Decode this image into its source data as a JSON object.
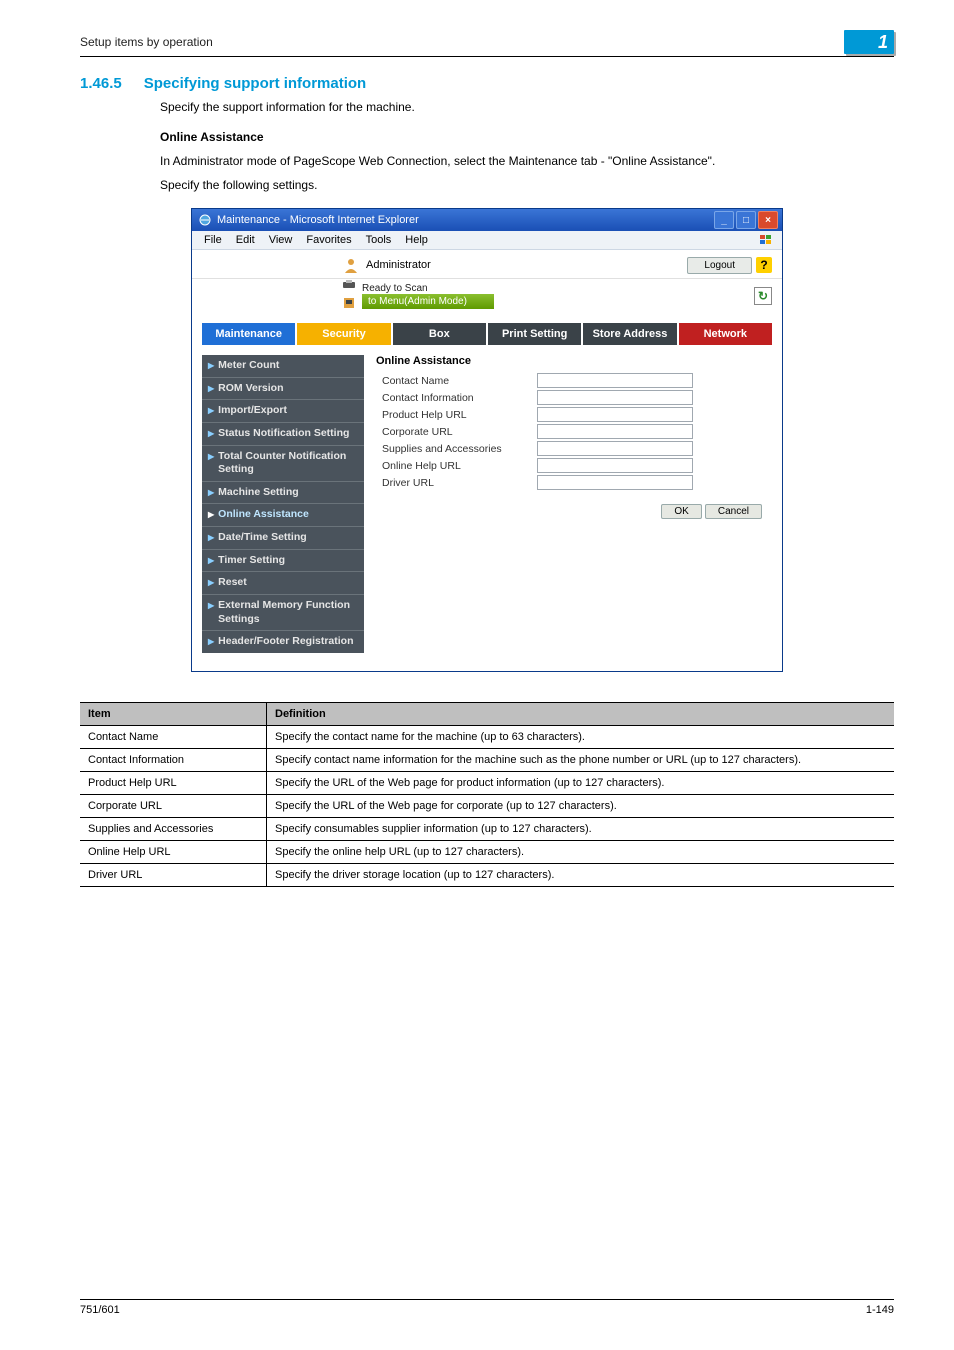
{
  "header": {
    "breadcrumb": "Setup items by operation",
    "chapter_number": "1"
  },
  "section": {
    "number": "1.46.5",
    "title": "Specifying support information",
    "intro": "Specify the support information for the machine.",
    "subheading": "Online Assistance",
    "para1": "In Administrator mode of PageScope Web Connection, select the Maintenance tab - \"Online Assistance\".",
    "para2": "Specify the following settings."
  },
  "chart_data": {
    "type": "table",
    "title": "Item / Definition",
    "columns": [
      "Item",
      "Definition"
    ],
    "rows": [
      [
        "Contact Name",
        "Specify the contact name for the machine (up to 63 characters)."
      ],
      [
        "Contact Information",
        "Specify contact name information for the machine such as the phone number or URL (up to 127 characters)."
      ],
      [
        "Product Help URL",
        "Specify the URL of the Web page for product information (up to 127 characters)."
      ],
      [
        "Corporate URL",
        "Specify the URL of the Web page for corporate (up to 127 characters)."
      ],
      [
        "Supplies and Accessories",
        "Specify consumables supplier information (up to 127 characters)."
      ],
      [
        "Online Help URL",
        "Specify the online help URL (up to 127 characters)."
      ],
      [
        "Driver URL",
        "Specify the driver storage location (up to 127 characters)."
      ]
    ]
  },
  "screenshot": {
    "window_title": "Maintenance - Microsoft Internet Explorer",
    "menus": [
      "File",
      "Edit",
      "View",
      "Favorites",
      "Tools",
      "Help"
    ],
    "admin_bar": {
      "role": "Administrator",
      "logout": "Logout",
      "help": "?"
    },
    "status": {
      "line1": "Ready to Scan",
      "line2": "to Menu(Admin Mode)",
      "refresh": "↻"
    },
    "tabs": [
      {
        "label": "Maintenance",
        "style": "blue"
      },
      {
        "label": "Security",
        "style": "gold"
      },
      {
        "label": "Box",
        "style": "dark"
      },
      {
        "label": "Print Setting",
        "style": "dark"
      },
      {
        "label": "Store Address",
        "style": "dark"
      },
      {
        "label": "Network",
        "style": "red"
      }
    ],
    "side_nav": [
      {
        "label": "Meter Count",
        "active": false
      },
      {
        "label": "ROM Version",
        "active": false
      },
      {
        "label": "Import/Export",
        "active": false
      },
      {
        "label": "Status Notification Setting",
        "active": false
      },
      {
        "label": "Total Counter Notification Setting",
        "active": false
      },
      {
        "label": "Machine Setting",
        "active": false
      },
      {
        "label": "Online Assistance",
        "active": true
      },
      {
        "label": "Date/Time Setting",
        "active": false
      },
      {
        "label": "Timer Setting",
        "active": false
      },
      {
        "label": "Reset",
        "active": false
      },
      {
        "label": "External Memory Function Settings",
        "active": false
      },
      {
        "label": "Header/Footer Registration",
        "active": false
      }
    ],
    "pane": {
      "title": "Online Assistance",
      "fields": [
        {
          "label": "Contact Name",
          "value": ""
        },
        {
          "label": "Contact Information",
          "value": ""
        },
        {
          "label": "Product Help URL",
          "value": ""
        },
        {
          "label": "Corporate URL",
          "value": ""
        },
        {
          "label": "Supplies and Accessories",
          "value": ""
        },
        {
          "label": "Online Help URL",
          "value": ""
        },
        {
          "label": "Driver URL",
          "value": ""
        }
      ],
      "ok": "OK",
      "cancel": "Cancel"
    }
  },
  "footer": {
    "left": "751/601",
    "right": "1-149"
  }
}
